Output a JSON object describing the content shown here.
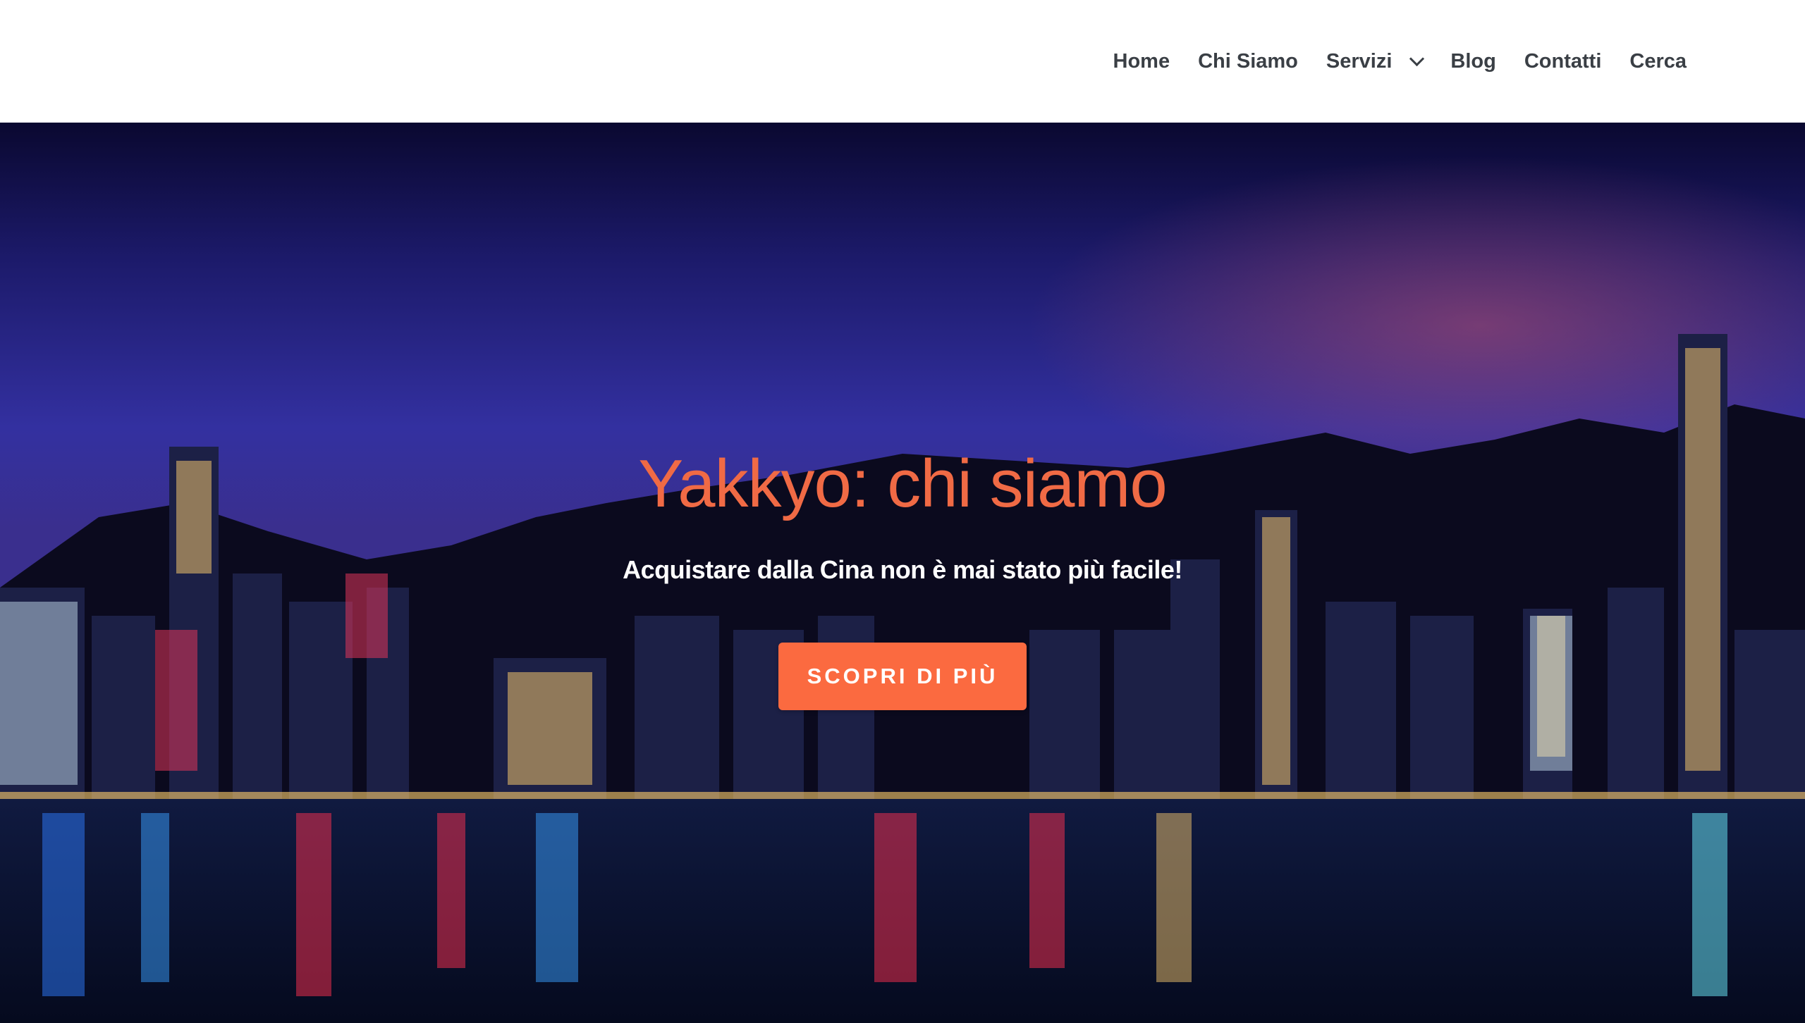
{
  "nav": {
    "items": [
      {
        "label": "Home"
      },
      {
        "label": "Chi Siamo"
      },
      {
        "label": "Servizi",
        "has_dropdown": true
      },
      {
        "label": "Blog"
      },
      {
        "label": "Contatti"
      },
      {
        "label": "Cerca"
      }
    ]
  },
  "hero": {
    "title": "Yakkyo: chi siamo",
    "subtitle": "Acquistare dalla Cina non è mai stato più facile!",
    "cta_label": "SCOPRI DI PIÙ",
    "background_image": "night skyline of a harbour city with illuminated skyscrapers reflected in the water"
  },
  "colors": {
    "accent": "#fb6a40",
    "title": "#f06a45",
    "nav_text": "#3a3f45",
    "header_bg": "#ffffff"
  }
}
